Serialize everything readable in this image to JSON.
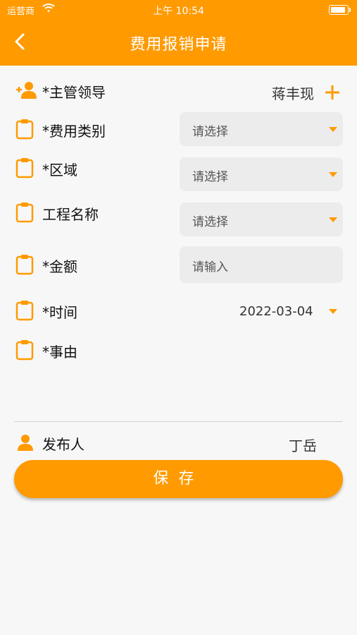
{
  "status_bar": {
    "carrier": "运营商",
    "time": "上午 10:54"
  },
  "header": {
    "title": "费用报销申请"
  },
  "form": {
    "supervisor": {
      "label": "*主管领导",
      "value": "蒋丰现"
    },
    "category": {
      "label": "*费用类别",
      "placeholder": "请选择"
    },
    "region": {
      "label": "*区域",
      "placeholder": "请选择"
    },
    "project": {
      "label": "工程名称",
      "placeholder": "请选择"
    },
    "amount": {
      "label": "*金额",
      "placeholder": "请输入"
    },
    "time": {
      "label": "*时间",
      "value": "2022-03-04"
    },
    "reason": {
      "label": "*事由"
    }
  },
  "publisher": {
    "label": "发布人",
    "value": "丁岳"
  },
  "save_label": "保存",
  "colors": {
    "accent": "#ff9a00",
    "field_bg": "#ececec",
    "page_bg": "#f7f7f7"
  },
  "icons": [
    "back-icon",
    "wifi-icon",
    "battery-icon",
    "add-person-icon",
    "clipboard-icon",
    "plus-icon",
    "caret-down-icon",
    "person-icon"
  ]
}
